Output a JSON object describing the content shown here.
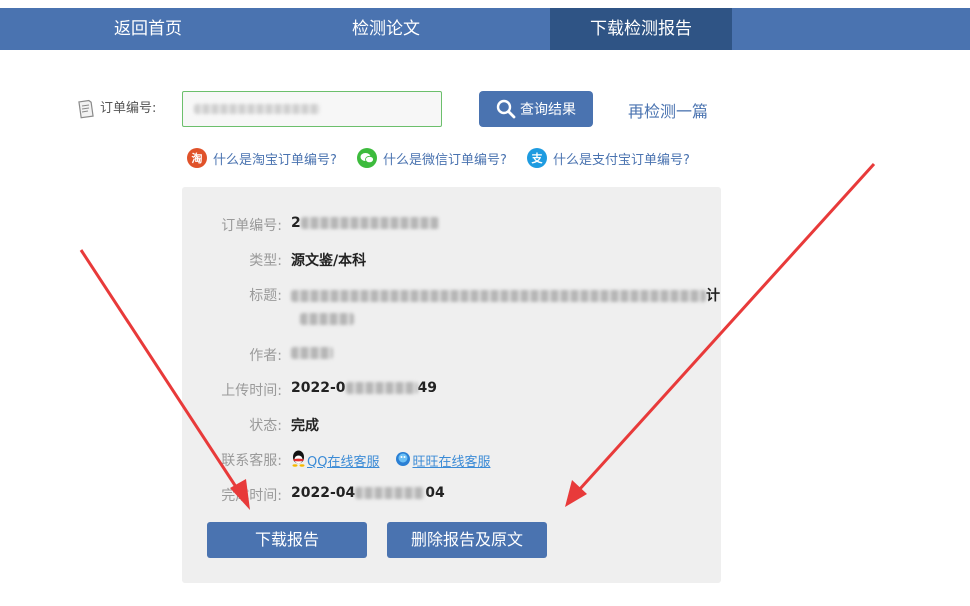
{
  "nav": {
    "items": [
      {
        "label": "返回首页"
      },
      {
        "label": "检测论文"
      },
      {
        "label": "下载检测报告",
        "active": true
      }
    ]
  },
  "search": {
    "order_label": "订单编号:",
    "input_placeholder": "",
    "query_button": "查询结果",
    "recheck_link": "再检测一篇"
  },
  "help_links": [
    {
      "icon": "taobao-icon",
      "icon_text": "淘",
      "color": "#e0522a",
      "label": "什么是淘宝订单编号?"
    },
    {
      "icon": "wechat-icon",
      "icon_text": "",
      "color": "#3dbb3d",
      "label": "什么是微信订单编号?"
    },
    {
      "icon": "alipay-icon",
      "icon_text": "支",
      "color": "#1e9be0",
      "label": "什么是支付宝订单编号?"
    }
  ],
  "report": {
    "order_no": {
      "label": "订单编号:",
      "value": "2"
    },
    "type": {
      "label": "类型:",
      "value": "源文鉴/本科"
    },
    "title": {
      "label": "标题:",
      "value_prefix": "",
      "value_suffix": "计"
    },
    "author": {
      "label": "作者:"
    },
    "upload_time": {
      "label": "上传时间:",
      "prefix": "2022-0",
      "suffix": "49"
    },
    "status": {
      "label": "状态:",
      "value": "完成"
    },
    "service": {
      "label": "联系客服:",
      "qq": "QQ在线客服",
      "wangwang": "旺旺在线客服"
    },
    "finish_time": {
      "label": "完成时间:",
      "prefix": "2022-04",
      "suffix": "04"
    }
  },
  "actions": {
    "download": "下载报告",
    "delete": "删除报告及原文"
  },
  "colors": {
    "nav_bg": "#4a73b0",
    "nav_active": "#2f5485",
    "button": "#4a73b0",
    "arrow": "#e83a3a",
    "card_bg": "#efefef"
  }
}
